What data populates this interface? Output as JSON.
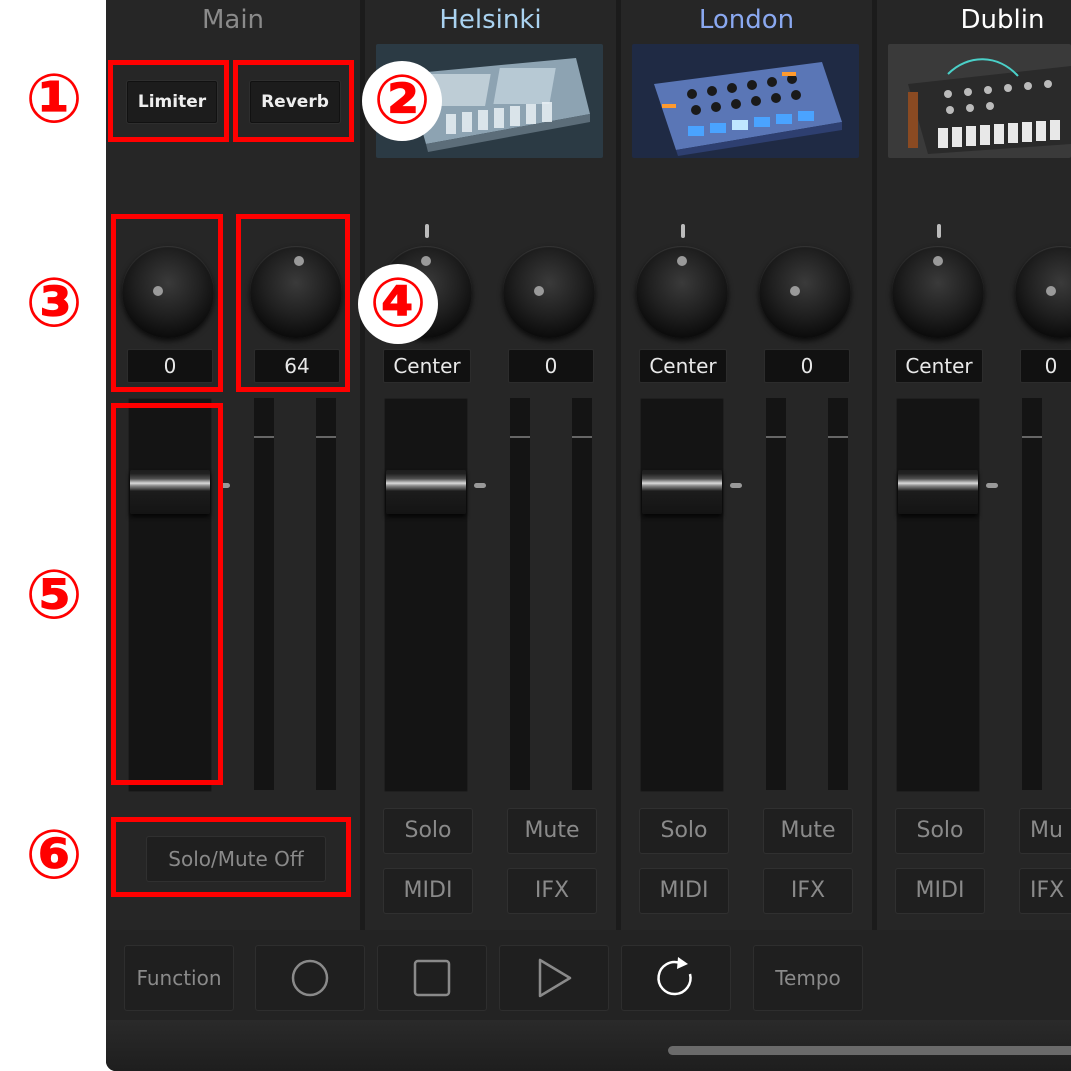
{
  "channels": [
    {
      "name": "Main",
      "name_color": "#8a8a8a"
    },
    {
      "name": "Helsinki",
      "name_color": "#a9d2f0"
    },
    {
      "name": "London",
      "name_color": "#8aa8f0"
    },
    {
      "name": "Dublin",
      "name_color": "#ffffff"
    }
  ],
  "main": {
    "limiter_label": "Limiter",
    "reverb_label": "Reverb",
    "knob1_value": "0",
    "knob2_value": "64",
    "solo_mute_off_label": "Solo/Mute Off"
  },
  "strips": [
    {
      "pan_value": "Center",
      "send_value": "0",
      "solo_label": "Solo",
      "mute_label": "Mute",
      "midi_label": "MIDI",
      "ifx_label": "IFX"
    },
    {
      "pan_value": "Center",
      "send_value": "0",
      "solo_label": "Solo",
      "mute_label": "Mute",
      "midi_label": "MIDI",
      "ifx_label": "IFX"
    },
    {
      "pan_value": "Center",
      "send_value": "0",
      "solo_label": "Solo",
      "mute_label": "Mu",
      "midi_label": "MIDI",
      "ifx_label": "IFX"
    }
  ],
  "transport": {
    "function_label": "Function",
    "tempo_label": "Tempo",
    "icons": [
      "record-icon",
      "stop-icon",
      "play-icon",
      "loop-icon"
    ]
  },
  "annotations": [
    "①",
    "②",
    "③",
    "④",
    "⑤",
    "⑥"
  ],
  "colors": {
    "annotation": "#ff0000",
    "background": "#222222"
  }
}
